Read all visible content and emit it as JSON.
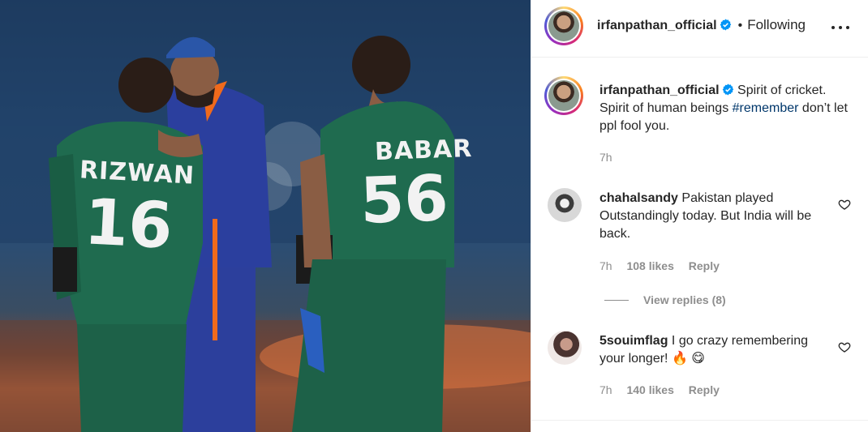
{
  "post": {
    "author": "irfanpathan_official",
    "follow_state": "Following",
    "caption_parts": {
      "text1": "Spirit of cricket. Spirit of human beings ",
      "hashtag": "#remember",
      "text2": " don’t let ppl fool you."
    },
    "time": "7h"
  },
  "photo": {
    "jersey_left_name": "RIZWAN",
    "jersey_left_number": "16",
    "jersey_right_name": "BABAR",
    "jersey_right_number": "56"
  },
  "comments": [
    {
      "username": "chahalsandy",
      "text": "Pakistan played Outstandingly today. But India will be back.",
      "time": "7h",
      "likes": "108 likes",
      "reply_label": "Reply",
      "view_replies": "View replies (8)"
    },
    {
      "username": "5souimflag",
      "text": "I go crazy remembering your longer! 🔥 😋",
      "time": "7h",
      "likes": "140 likes",
      "reply_label": "Reply"
    }
  ],
  "colors": {
    "link_blue": "#00376b",
    "verified_blue": "#0095f6",
    "muted_text": "#8e8e8e",
    "pakistan_green": "#1f6b4f",
    "india_blue": "#2b3f9e"
  },
  "icons": [
    "verified-icon",
    "more-options-icon",
    "heart-icon"
  ]
}
